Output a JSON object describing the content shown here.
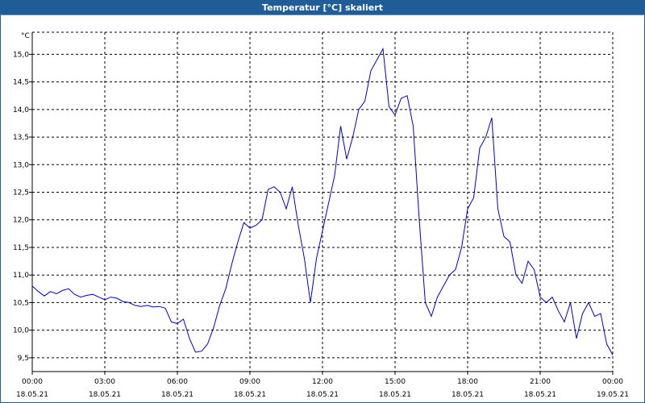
{
  "window": {
    "title": "Temperatur [°C] skaliert"
  },
  "colors": {
    "title_bar": "#1f5d99",
    "line": "#0000cc",
    "grid": "#000000",
    "axis": "#000000",
    "background": "#ffffff"
  },
  "chart_data": {
    "type": "line",
    "title": "Temperatur [°C] skaliert",
    "ylabel": "°C",
    "xlabel": "",
    "ylim": [
      9.25,
      15.4
    ],
    "xlim": [
      0,
      24
    ],
    "grid": true,
    "y_ticks": [
      "9,5",
      "10,0",
      "10,5",
      "11,0",
      "11,5",
      "12,0",
      "12,5",
      "13,0",
      "13,5",
      "14,0",
      "14,5",
      "15,0"
    ],
    "y_tick_values": [
      9.5,
      10.0,
      10.5,
      11.0,
      11.5,
      12.0,
      12.5,
      13.0,
      13.5,
      14.0,
      14.5,
      15.0
    ],
    "x_ticks": [
      {
        "time": "00:00",
        "date": "18.05.21"
      },
      {
        "time": "03:00",
        "date": "18.05.21"
      },
      {
        "time": "06:00",
        "date": "18.05.21"
      },
      {
        "time": "09:00",
        "date": "18.05.21"
      },
      {
        "time": "12:00",
        "date": "18.05.21"
      },
      {
        "time": "15:00",
        "date": "18.05.21"
      },
      {
        "time": "18:00",
        "date": "18.05.21"
      },
      {
        "time": "21:00",
        "date": "18.05.21"
      },
      {
        "time": "00:00",
        "date": "19.05.21"
      }
    ],
    "x_tick_values": [
      0,
      3,
      6,
      9,
      12,
      15,
      18,
      21,
      24
    ],
    "series": [
      {
        "x": [
          0.0,
          0.25,
          0.5,
          0.75,
          1.0,
          1.25,
          1.5,
          1.75,
          2.0,
          2.25,
          2.5,
          2.75,
          3.0,
          3.25,
          3.5,
          3.75,
          4.0,
          4.25,
          4.5,
          4.75,
          5.0,
          5.25,
          5.5,
          5.75,
          6.0,
          6.25,
          6.5,
          6.75,
          7.0,
          7.25,
          7.5,
          7.75,
          8.0,
          8.25,
          8.5,
          8.75,
          9.0,
          9.25,
          9.5,
          9.75,
          10.0,
          10.25,
          10.5,
          10.75,
          11.0,
          11.25,
          11.5,
          11.75,
          12.0,
          12.25,
          12.5,
          12.75,
          13.0,
          13.25,
          13.5,
          13.75,
          14.0,
          14.25,
          14.5,
          14.75,
          15.0,
          15.25,
          15.5,
          15.75,
          16.0,
          16.25,
          16.5,
          16.75,
          17.0,
          17.25,
          17.5,
          17.75,
          18.0,
          18.25,
          18.5,
          18.75,
          19.0,
          19.25,
          19.5,
          19.75,
          20.0,
          20.25,
          20.5,
          20.75,
          21.0,
          21.25,
          21.5,
          21.75,
          22.0,
          22.25,
          22.5,
          22.75,
          23.0,
          23.25,
          23.5,
          23.75,
          24.0
        ],
        "y": [
          10.8,
          10.7,
          10.62,
          10.7,
          10.66,
          10.72,
          10.75,
          10.65,
          10.6,
          10.63,
          10.65,
          10.6,
          10.55,
          10.6,
          10.58,
          10.52,
          10.5,
          10.45,
          10.43,
          10.45,
          10.42,
          10.43,
          10.4,
          10.15,
          10.12,
          10.2,
          9.85,
          9.6,
          9.62,
          9.75,
          10.05,
          10.45,
          10.75,
          11.2,
          11.6,
          11.95,
          11.85,
          11.9,
          12.0,
          12.55,
          12.6,
          12.5,
          12.2,
          12.6,
          11.9,
          11.3,
          10.5,
          11.3,
          11.8,
          12.3,
          12.8,
          13.7,
          13.1,
          13.5,
          14.0,
          14.15,
          14.7,
          14.9,
          15.1,
          14.05,
          13.9,
          14.2,
          14.25,
          13.7,
          12.0,
          10.5,
          10.25,
          10.6,
          10.8,
          11.0,
          11.1,
          11.5,
          12.2,
          12.4,
          13.3,
          13.5,
          13.85,
          12.2,
          11.7,
          11.6,
          11.0,
          10.85,
          11.25,
          11.1,
          10.6,
          10.5,
          10.6,
          10.35,
          10.15,
          10.5,
          9.85,
          10.3,
          10.5,
          10.25,
          10.3,
          9.75,
          9.55
        ]
      }
    ]
  }
}
